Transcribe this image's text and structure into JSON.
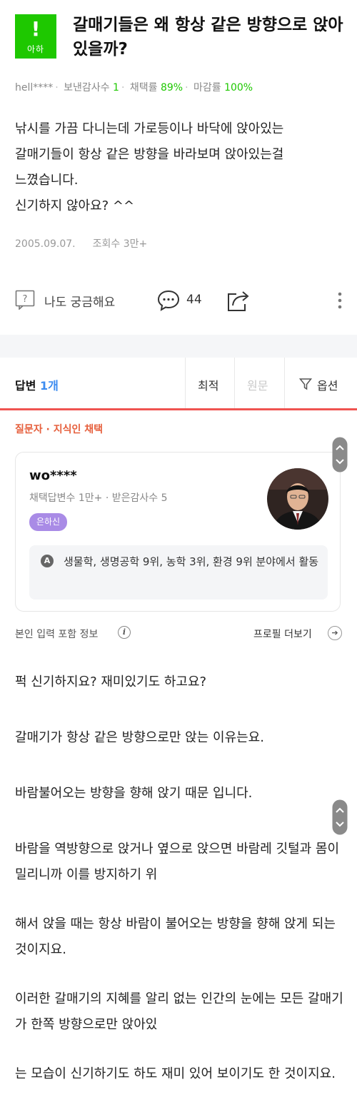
{
  "question": {
    "badge": {
      "mark": "!",
      "label": "아하"
    },
    "title": "갈매기들은 왜 항상 같은 방향으로 앉아있을까?",
    "author": "hell****",
    "stats": [
      {
        "label": "보낸감사수",
        "value": "1"
      },
      {
        "label": "채택률",
        "value": "89%"
      },
      {
        "label": "마감률",
        "value": "100%"
      }
    ],
    "body_lines": [
      "낚시를 가끔 다니는데 가로등이나 바닥에 앉아있는",
      "갈매기들이 항상 같은 방향을 바라보며 앉아있는걸",
      "느꼈습니다.",
      "신기하지 않아요? ^^"
    ],
    "date": "2005.09.07.",
    "views": "조회수 3만+",
    "curious_label": "나도 궁금해요",
    "comment_count": "44"
  },
  "answers_header": {
    "title": "답변",
    "count": "1개",
    "sort_best": "최적",
    "sort_original": "원문",
    "options": "옵션"
  },
  "answer": {
    "selected_label": "질문자 · 지식인 채택",
    "name": "wo****",
    "stats": "채택답변수 1만+ · 받은감사수 5",
    "grade": "은하신",
    "field_icon": "A",
    "field_text": "생물학, 생명공학 9위, 농학 3위, 환경 9위 분야에서 활동",
    "self_info": "본인 입력 포함 정보",
    "info_icon": "i",
    "profile_more": "프로필 더보기",
    "paragraphs": [
      "퍽 신기하지요? 재미있기도 하고요?",
      "갈매기가 항상 같은 방향으로만 앉는 이유는요.",
      "바람불어오는 방향을 향해 앉기 때문 입니다.",
      "바람을 역방향으로 앉거나 옆으로 앉으면 바람레 깃털과 몸이 밀리니까 이를 방지하기 위",
      "해서 앉을 때는 항상 바람이 불어오는 방향을 향해 앉게 되는 것이지요.",
      "이러한 갈매기의 지혜를 알리 없는 인간의 눈에는 모든 갈매기가 한쪽 방향으로만 앉아있",
      "는 모습이 신기하기도 하도 재미 있어 보이기도 한 것이지요."
    ]
  },
  "colors": {
    "brand_green": "#1ec800",
    "accent_red": "#ef5350",
    "count_blue": "#3b8bf0",
    "grade_purple": "#a98be6"
  },
  "icons": [
    "question-bubble-icon",
    "comment-icon",
    "share-icon",
    "more-vertical-icon",
    "filter-icon",
    "chevron-up-icon",
    "chevron-down-icon",
    "info-icon",
    "arrow-right-circle-icon"
  ]
}
